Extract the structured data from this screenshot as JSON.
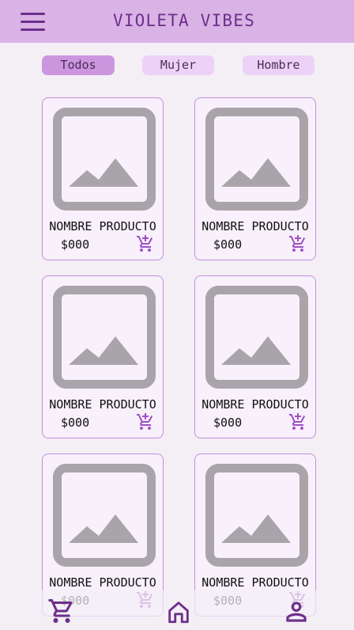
{
  "header": {
    "title": "VIOLETA VIBES",
    "menu_icon": "hamburger-menu-icon"
  },
  "filters": [
    {
      "label": "Todos",
      "active": true
    },
    {
      "label": "Mujer",
      "active": false
    },
    {
      "label": "Hombre",
      "active": false
    }
  ],
  "products": [
    {
      "name": "NOMBRE PRODUCTO",
      "price": "$000",
      "image_icon": "image-placeholder-icon",
      "cart_icon": "add-to-cart-icon"
    },
    {
      "name": "NOMBRE PRODUCTO",
      "price": "$000",
      "image_icon": "image-placeholder-icon",
      "cart_icon": "add-to-cart-icon"
    },
    {
      "name": "NOMBRE PRODUCTO",
      "price": "$000",
      "image_icon": "image-placeholder-icon",
      "cart_icon": "add-to-cart-icon"
    },
    {
      "name": "NOMBRE PRODUCTO",
      "price": "$000",
      "image_icon": "image-placeholder-icon",
      "cart_icon": "add-to-cart-icon"
    },
    {
      "name": "NOMBRE PRODUCTO",
      "price": "$000",
      "image_icon": "image-placeholder-icon",
      "cart_icon": "add-to-cart-icon"
    },
    {
      "name": "NOMBRE PRODUCTO",
      "price": "$000",
      "image_icon": "image-placeholder-icon",
      "cart_icon": "add-to-cart-icon"
    }
  ],
  "bottom_nav": [
    {
      "icon": "shopping-cart-icon"
    },
    {
      "icon": "home-icon"
    },
    {
      "icon": "user-profile-icon"
    }
  ],
  "colors": {
    "header_bg": "#d9b2e6",
    "accent": "#6d2f8a",
    "chip_active": "#cc96df",
    "chip": "#ecd2f6",
    "card_border": "#c28ee0",
    "card_bg": "#f8f0fa",
    "placeholder_gray": "#a9a4a9",
    "cart_icon": "#9c4fc7"
  }
}
